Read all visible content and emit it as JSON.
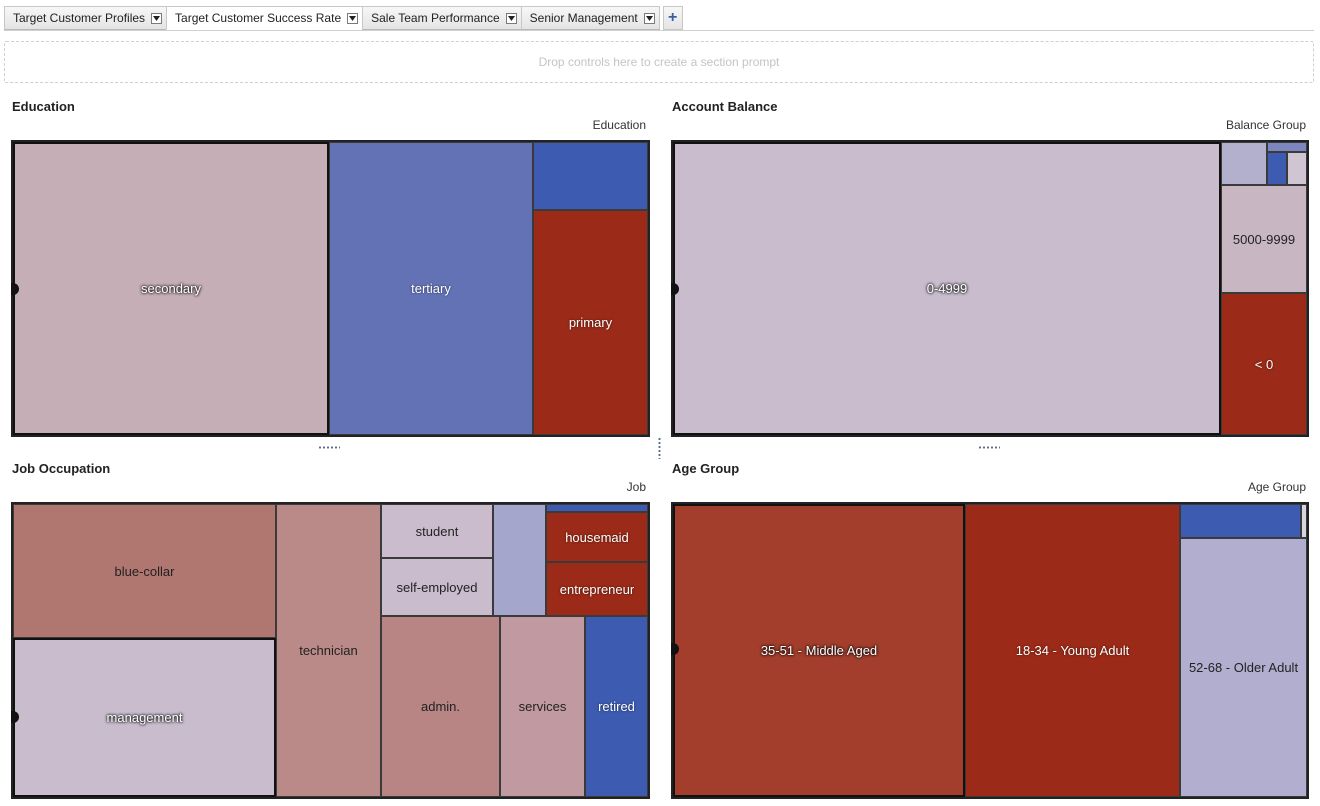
{
  "tabs": [
    {
      "label": "Target Customer Profiles",
      "active": false
    },
    {
      "label": "Target Customer Success Rate",
      "active": true
    },
    {
      "label": "Sale Team Performance",
      "active": false
    },
    {
      "label": "Senior Management",
      "active": false
    }
  ],
  "add_tab_icon": "plus-icon",
  "dropzone": {
    "text": "Drop controls here to create a section prompt"
  },
  "colors": {
    "dark_red": "#9b2a18",
    "mid_red": "#a33e2d",
    "rose": "#b07670",
    "light_rose": "#c5aeb6",
    "lavender": "#c8bccd",
    "periwinkle": "#6272b5",
    "blue": "#3d5bb1",
    "light_blue": "#a4a6cb"
  },
  "education": {
    "title": "Education",
    "dimension": "Education",
    "tiles": {
      "secondary": "secondary",
      "tertiary": "tertiary",
      "unknown_small": "",
      "primary": "primary"
    }
  },
  "balance": {
    "title": "Account Balance",
    "dimension": "Balance Group",
    "tiles": {
      "b0_4999": "0-4999",
      "b5000_9999": "5000-9999",
      "neg": "< 0"
    }
  },
  "job": {
    "title": "Job Occupation",
    "dimension": "Job",
    "tiles": {
      "blue_collar": "blue-collar",
      "management": "management",
      "technician": "technician",
      "student": "student",
      "self_employed": "self-employed",
      "housemaid": "housemaid",
      "entrepreneur": "entrepreneur",
      "admin": "admin.",
      "services": "services",
      "retired": "retired"
    }
  },
  "age": {
    "title": "Age Group",
    "dimension": "Age Group",
    "tiles": {
      "middle": "35-51 - Middle Aged",
      "young": "18-34 - Young Adult",
      "older": "52-68 - Older Adult"
    }
  }
}
